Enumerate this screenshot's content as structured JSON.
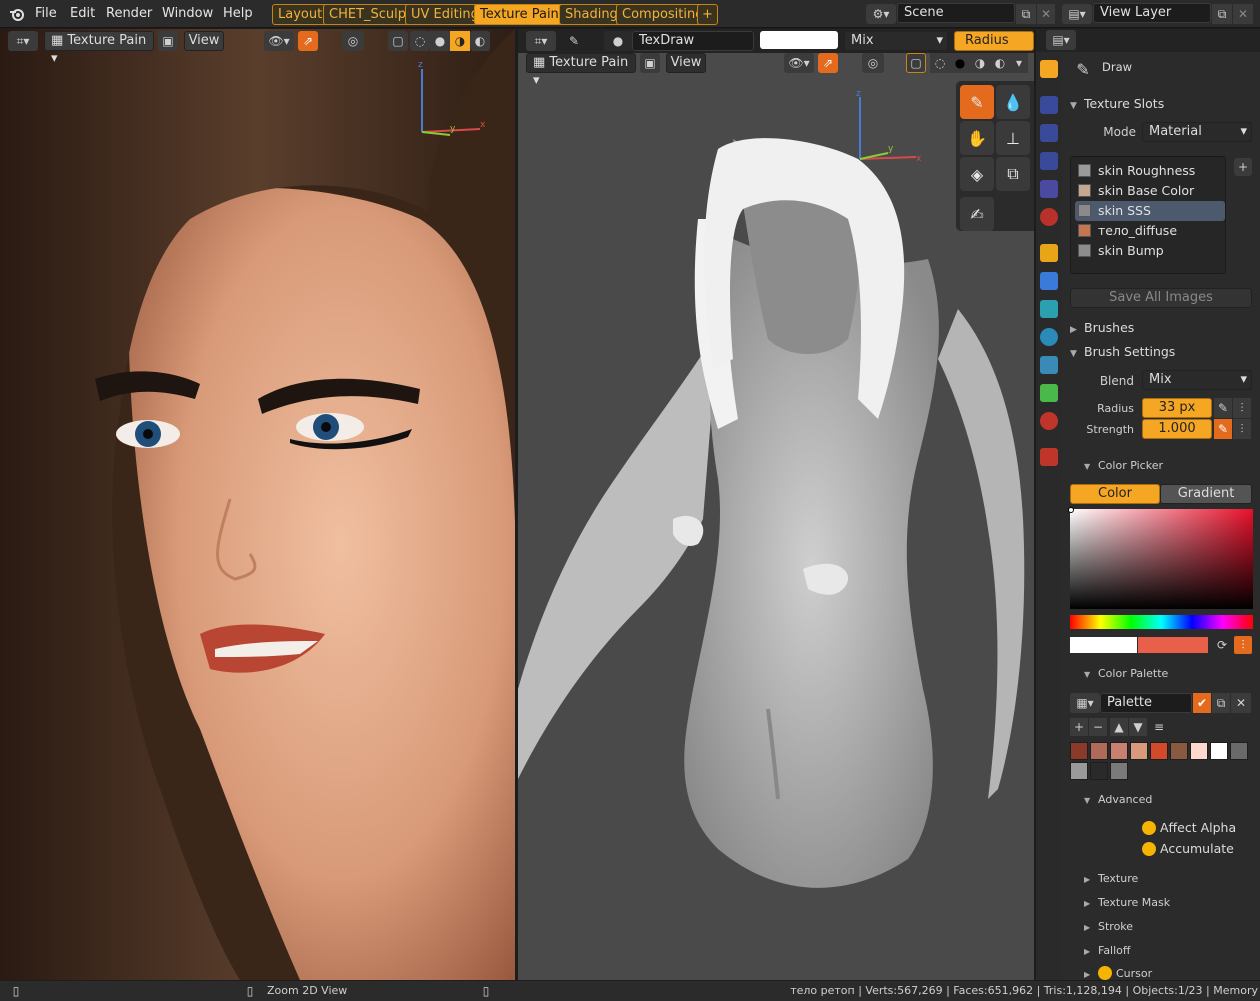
{
  "menu": [
    "File",
    "Edit",
    "Render",
    "Window",
    "Help"
  ],
  "workspaces": [
    {
      "label": "Layout",
      "active": false
    },
    {
      "label": "CHET_Sculpt",
      "active": false
    },
    {
      "label": "UV Editing",
      "active": false
    },
    {
      "label": "Texture Paint",
      "active": true
    },
    {
      "label": "Shading",
      "active": false
    },
    {
      "label": "Compositing",
      "active": false
    }
  ],
  "add_workspace": "+",
  "scene": "Scene",
  "view_layer": "View Layer",
  "left_view": {
    "mode": "Texture Pain",
    "view": "View"
  },
  "mid_view": {
    "mode": "Texture Pain",
    "view": "View",
    "brush": "TexDraw",
    "blend": "Mix",
    "radius_tab": "Radius"
  },
  "props": {
    "tool_name": "Draw",
    "texture_slots": {
      "title": "Texture Slots",
      "mode_label": "Mode",
      "mode_value": "Material",
      "slots": [
        {
          "name": "skin Roughness",
          "color": "#9a9a9a",
          "selected": false
        },
        {
          "name": "skin Base Color",
          "color": "#c6a890",
          "selected": false
        },
        {
          "name": "skin SSS",
          "color": "#8a8a8a",
          "selected": true
        },
        {
          "name": "тело_diffuse",
          "color": "#c47650",
          "selected": false
        },
        {
          "name": "skin Bump",
          "color": "#8c8c8c",
          "selected": false
        }
      ],
      "save_all": "Save All Images"
    },
    "brushes": "Brushes",
    "brush_settings": {
      "title": "Brush Settings",
      "blend_label": "Blend",
      "blend_value": "Mix",
      "radius_label": "Radius",
      "radius_value": "33 px",
      "strength_label": "Strength",
      "strength_value": "1.000"
    },
    "color_picker": {
      "title": "Color Picker",
      "tab_color": "Color",
      "tab_gradient": "Gradient",
      "primary": "#ffffff",
      "secondary": "#e8604a"
    },
    "color_palette": {
      "title": "Color Palette",
      "name": "Palette",
      "swatches": [
        "#8a3a2a",
        "#b06a5a",
        "#c98070",
        "#d89a7a",
        "#d24a2a",
        "#8a5a40",
        "#ffd8cc",
        "#ffffff",
        "#6a6a6a",
        "#9a9a9a",
        "#2a2a2a",
        "#7a7a7a"
      ]
    },
    "advanced": {
      "title": "Advanced",
      "affect_alpha": "Affect Alpha",
      "accumulate": "Accumulate"
    },
    "collapsed": [
      "Texture",
      "Texture Mask",
      "Stroke",
      "Falloff"
    ],
    "cursor": "Cursor"
  },
  "status": {
    "zoom": "Zoom 2D View",
    "stats": "тело ретоп | Verts:567,269 | Faces:651,962 | Tris:1,128,194 | Objects:1/23 | Memory"
  },
  "colors": {
    "accent": "#f5a623",
    "panel": "#2b2b2b",
    "header": "#232323"
  }
}
